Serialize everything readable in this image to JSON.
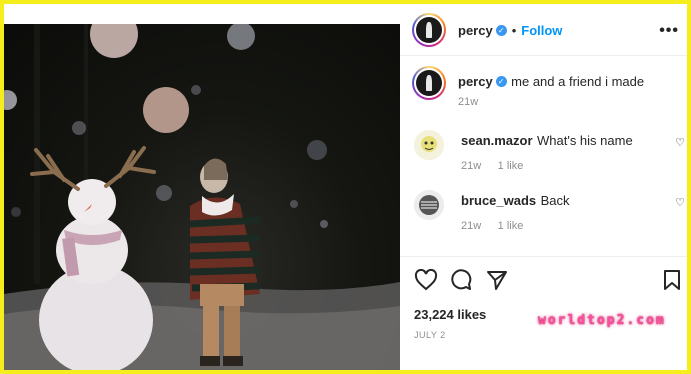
{
  "post": {
    "username": "percy",
    "follow_label": "Follow",
    "more_label": "•••",
    "caption": "me and a friend i made",
    "caption_age": "21w"
  },
  "comments": [
    {
      "username": "sean.mazor",
      "text": "What's his name",
      "age": "21w",
      "likes": "1 like"
    },
    {
      "username": "bruce_wads",
      "text": "Back",
      "age": "21w",
      "likes": "1 like"
    }
  ],
  "footer": {
    "likes": "23,224 likes",
    "date": "JULY 2",
    "watermark": "worldtop2.com"
  },
  "icons": {
    "verified": "verified-badge-icon",
    "like": "heart-icon",
    "comment": "comment-icon",
    "share": "share-icon",
    "save": "bookmark-icon"
  },
  "colors": {
    "follow": "#0095f6",
    "verified": "#3897f0",
    "frame": "#f6ee1c"
  }
}
